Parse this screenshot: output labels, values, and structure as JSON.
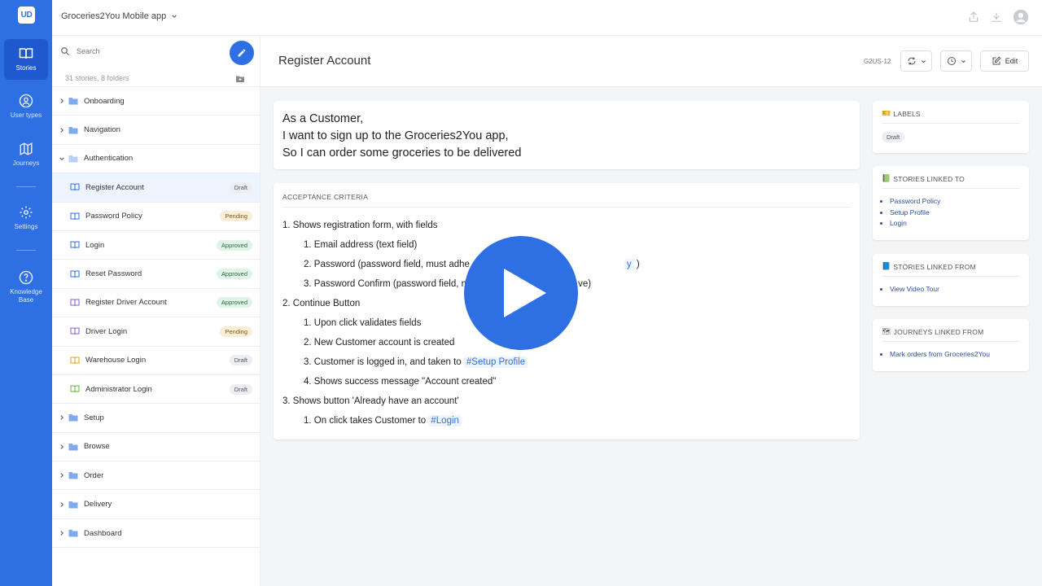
{
  "app": {
    "logo_text": "UD",
    "project_name": "Groceries2You Mobile app"
  },
  "nav": [
    {
      "label": "Stories",
      "icon": "book-icon",
      "active": true
    },
    {
      "label": "User types",
      "icon": "user-circle-icon"
    },
    {
      "label": "Journeys",
      "icon": "map-icon"
    },
    {
      "label": "Settings",
      "icon": "gear-icon"
    },
    {
      "label": "Knowledge Base",
      "icon": "help-circle-icon"
    }
  ],
  "search": {
    "placeholder": "Search"
  },
  "story_count": "31 stories, 8 folders",
  "folders_top": [
    {
      "name": "Onboarding"
    },
    {
      "name": "Navigation"
    },
    {
      "name": "Authentication",
      "expanded": true
    }
  ],
  "stories": [
    {
      "name": "Register Account",
      "status": "Draft",
      "icon_color": "#2f6fe4"
    },
    {
      "name": "Password Policy",
      "status": "Pending",
      "icon_color": "#2f6fe4"
    },
    {
      "name": "Login",
      "status": "Approved",
      "icon_color": "#2f6fe4"
    },
    {
      "name": "Reset Password",
      "status": "Approved",
      "icon_color": "#2f6fe4"
    },
    {
      "name": "Register Driver Account",
      "status": "Approved",
      "icon_color": "#8a5fd6"
    },
    {
      "name": "Driver Login",
      "status": "Pending",
      "icon_color": "#8a5fd6"
    },
    {
      "name": "Warehouse Login",
      "status": "Draft",
      "icon_color": "#e0a21b"
    },
    {
      "name": "Administrator Login",
      "status": "Draft",
      "icon_color": "#69b33a"
    }
  ],
  "folders_bottom": [
    {
      "name": "Setup"
    },
    {
      "name": "Browse"
    },
    {
      "name": "Order"
    },
    {
      "name": "Delivery"
    },
    {
      "name": "Dashboard"
    }
  ],
  "story": {
    "title": "Register Account",
    "id": "G2US-12",
    "edit_label": "Edit",
    "statement": [
      "As a Customer,",
      "I want to sign up to the Groceries2You app,",
      "So I can order some groceries to be delivered"
    ],
    "criteria_heading": "ACCEPTANCE CRITERIA",
    "criteria": {
      "c1": "1. Shows registration form, with fields",
      "c1a": "1. Email address (text field)",
      "c1b_pre": "2. Password (password field, must adhe",
      "c1b_post": " )",
      "c1b_tag": "y",
      "c1c_pre": "3. Password Confirm (password field, n",
      "c1c_post": "ve)",
      "c2": "2. Continue Button",
      "c2a": "1. Upon click validates fields",
      "c2b": "2. New Customer account is created",
      "c2c_pre": "3. Customer is logged in, and taken to ",
      "c2c_tag": "#Setup Profile",
      "c2d": "4. Shows success message \"Account created\"",
      "c3": "3. Shows button 'Already have an account'",
      "c3a_pre": "1. On click takes Customer to ",
      "c3a_tag": "#Login"
    }
  },
  "sidebar": {
    "labels": {
      "heading": "LABELS",
      "emoji": "🎫",
      "badge": "Draft"
    },
    "linked_to": {
      "heading": "STORIES LINKED TO",
      "emoji": "📗",
      "items": [
        "Password Policy",
        "Setup Profile",
        "Login"
      ]
    },
    "linked_from": {
      "heading": "STORIES LINKED FROM",
      "emoji": "📘",
      "items": [
        "View Video Tour"
      ]
    },
    "journeys": {
      "heading": "JOURNEYS LINKED FROM",
      "emoji": "🗺",
      "items": [
        "Mark orders from Groceries2You"
      ]
    }
  },
  "colors": {
    "brand": "#2f6fe4"
  }
}
